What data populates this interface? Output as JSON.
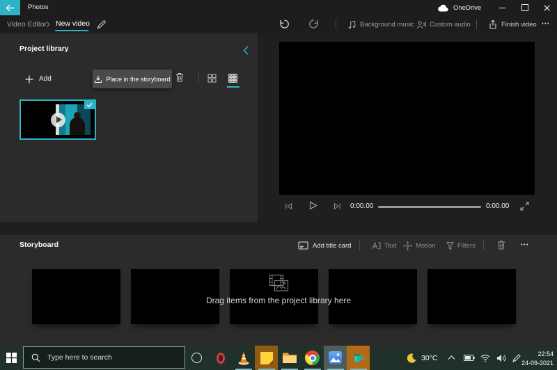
{
  "titlebar": {
    "app_title": "Photos",
    "onedrive_label": "OneDrive"
  },
  "nav": {
    "breadcrumb_root": "Video Editor",
    "project_name": "New video"
  },
  "top_toolbar": {
    "background_music_label": "Background music",
    "custom_audio_label": "Custom audio",
    "finish_video_label": "Finish video",
    "more_glyph": "•••"
  },
  "project_library": {
    "title": "Project library",
    "add_label": "Add",
    "place_in_storyboard_label": "Place in the storyboard"
  },
  "player": {
    "current_time": "0:00.00",
    "total_time": "0:00.00"
  },
  "storyboard": {
    "title": "Storyboard",
    "add_title_card_label": "Add title card",
    "text_label": "Text",
    "motion_label": "Motion",
    "filters_label": "Filters",
    "more_glyph": "•••",
    "empty_message": "Drag items from the project library here",
    "placeholder_slots": 5
  },
  "taskbar": {
    "search_placeholder": "Type here to search",
    "temperature": "30°C",
    "clock_time": "22:54",
    "clock_date": "24-09-2021",
    "pinned_apps": [
      "cortana",
      "opera",
      "vlc",
      "sticky-notes",
      "file-explorer",
      "chrome",
      "photos",
      "mug-app"
    ]
  },
  "colors": {
    "accent": "#2eb3c6",
    "panel_bg": "#2b2b2b",
    "window_bg": "#1f1f1f",
    "taskbar_bg": "#20302a",
    "place_button_bg": "#4a4a4a"
  },
  "icons": {
    "back": "left-arrow",
    "onedrive": "cloud",
    "minimize": "–",
    "maximize": "▢",
    "close": "✕",
    "rename": "pencil",
    "undo": "arrow-ccw",
    "redo": "arrow-cw",
    "background_music": "music-note",
    "custom_audio": "person-sound",
    "finish_video": "share-out",
    "collapse": "chevron-left",
    "add": "plus",
    "place": "arrow-into-tray",
    "delete": "trash-can",
    "grid_small": "grid-2x2",
    "grid_large": "grid-3x3",
    "selected": "checkmark",
    "previous_frame": "bar-triangle-left",
    "play": "triangle-right",
    "next_frame": "bar-triangle-right",
    "fullscreen": "diagonal-arrows",
    "add_title_card": "card",
    "text": "letter-a-bracket",
    "motion": "move-crosshair",
    "filters": "funnel",
    "empty_storyboard": "filmstrip-photo",
    "start": "windows-logo",
    "search": "magnifier",
    "weather": "crescent-moon",
    "tray_expand": "chevron-up",
    "battery": "battery",
    "network": "wifi",
    "volume": "speaker",
    "ink": "pen"
  }
}
